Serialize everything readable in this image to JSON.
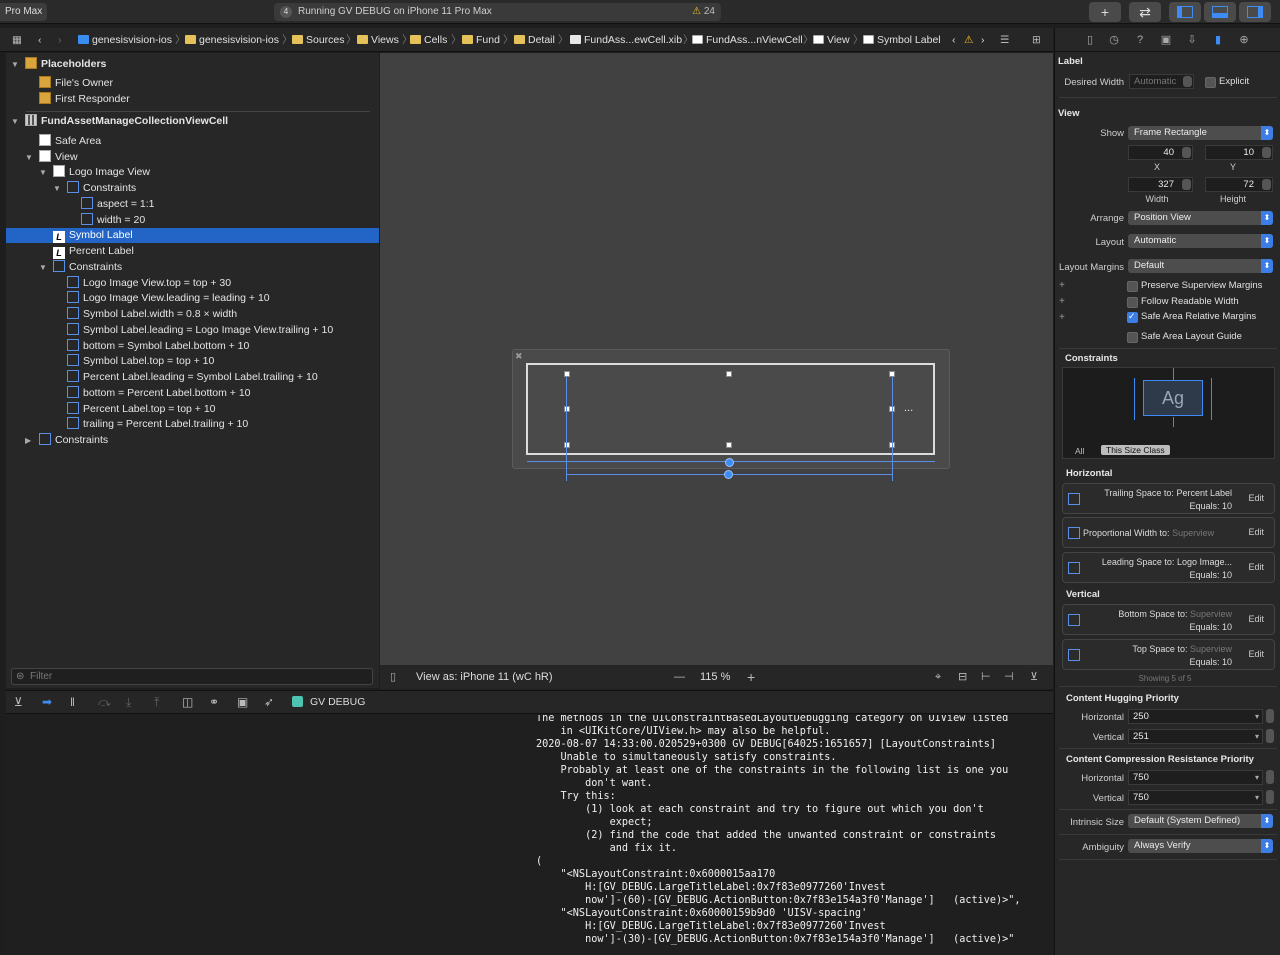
{
  "toolbar": {
    "scheme_label": "Pro Max",
    "activity_number": "4",
    "activity_text": "Running GV DEBUG on iPhone 11 Pro Max",
    "warning_count": "24",
    "warning_icon": "⚠",
    "add_icon": "+",
    "swap_icon": "⇄"
  },
  "jumpbar": {
    "crumbs": [
      "genesisvision-ios",
      "genesisvision-ios",
      "Sources",
      "Views",
      "Cells",
      "Fund",
      "Detail",
      "FundAss...ewCell.xib",
      "FundAss...nViewCell",
      "View",
      "Symbol Label"
    ]
  },
  "navigator": {
    "placeholders": "Placeholders",
    "files_owner": "File's Owner",
    "first_responder": "First Responder",
    "cell": "FundAssetManageCollectionViewCell",
    "safe_area": "Safe Area",
    "view": "View",
    "logo_image_view": "Logo Image View",
    "constraints_inner": "Constraints",
    "aspect": "aspect = 1:1",
    "width_20": "width = 20",
    "symbol_label": "Symbol Label",
    "percent_label": "Percent Label",
    "constraints": "Constraints",
    "c_rows": [
      "Logo Image View.top = top + 30",
      "Logo Image View.leading = leading + 10",
      "Symbol Label.width = 0.8 × width",
      "Symbol Label.leading = Logo Image View.trailing + 10",
      "bottom = Symbol Label.bottom + 10",
      "Symbol Label.top = top + 10",
      "Percent Label.leading = Symbol Label.trailing + 10",
      "bottom = Percent Label.bottom + 10",
      "Percent Label.top = top + 10",
      "trailing = Percent Label.trailing + 10"
    ],
    "constraints_outer": "Constraints",
    "filter_placeholder": "Filter"
  },
  "canvas": {
    "view_as": "View as: iPhone 11 (wC hR)",
    "zoom": "115 %",
    "zoom_minus": "—",
    "zoom_plus": "+",
    "ellipsis": "..."
  },
  "debug": {
    "target": "GV DEBUG"
  },
  "console": {
    "lines": [
      "The methods in the UIConstraintBasedLayoutDebugging category on UIView listed",
      "    in <UIKitCore/UIView.h> may also be helpful.",
      "2020-08-07 14:33:00.020529+0300 GV DEBUG[64025:1651657] [LayoutConstraints]",
      "    Unable to simultaneously satisfy constraints.",
      "    Probably at least one of the constraints in the following list is one you",
      "        don't want.",
      "    Try this:",
      "        (1) look at each constraint and try to figure out which you don't",
      "            expect;",
      "        (2) find the code that added the unwanted constraint or constraints",
      "            and fix it.",
      "(",
      "    \"<NSLayoutConstraint:0x6000015aa170",
      "        H:[GV_DEBUG.LargeTitleLabel:0x7f83e0977260'Invest",
      "        now']-(60)-[GV_DEBUG.ActionButton:0x7f83e154a3f0'Manage']   (active)>\",",
      "    \"<NSLayoutConstraint:0x60000159b9d0 'UISV-spacing'",
      "        H:[GV_DEBUG.LargeTitleLabel:0x7f83e0977260'Invest",
      "        now']-(30)-[GV_DEBUG.ActionButton:0x7f83e154a3f0'Manage']   (active)>\""
    ]
  },
  "inspector": {
    "label_section": "Label",
    "desired_width_label": "Desired Width",
    "desired_width_value": "Automatic",
    "explicit": "Explicit",
    "view_section": "View",
    "show_label": "Show",
    "show_value": "Frame Rectangle",
    "x_value": "40",
    "y_value": "10",
    "x_label": "X",
    "y_label": "Y",
    "width_value": "327",
    "height_value": "72",
    "width_label": "Width",
    "height_label": "Height",
    "arrange_label": "Arrange",
    "arrange_value": "Position View",
    "layout_label": "Layout",
    "layout_value": "Automatic",
    "layout_margins_label": "Layout Margins",
    "layout_margins_value": "Default",
    "preserve": "Preserve Superview Margins",
    "follow": "Follow Readable Width",
    "safe_area_margins": "Safe Area Relative Margins",
    "safe_area_guide": "Safe Area Layout Guide",
    "constraints_section": "Constraints",
    "ag": "Ag",
    "tab_all": "All",
    "tab_size_class": "This Size Class",
    "horizontal_section": "Horizontal",
    "h1_title": "Trailing Space to:",
    "h1_target": "Percent Label",
    "h1_eq": "Equals: 10",
    "h2_title": "Proportional Width to:",
    "h2_target": "Superview",
    "h3_title": "Leading Space to:",
    "h3_target": "Logo Image...",
    "h3_eq": "Equals: 10",
    "vertical_section": "Vertical",
    "v1_title": "Bottom Space to:",
    "v1_target": "Superview",
    "v1_eq": "Equals: 10",
    "v2_title": "Top Space to:",
    "v2_target": "Superview",
    "v2_eq": "Equals: 10",
    "edit": "Edit",
    "showing": "Showing 5 of 5",
    "hugging_section": "Content Hugging Priority",
    "hugging_h_label": "Horizontal",
    "hugging_h": "250",
    "hugging_v_label": "Vertical",
    "hugging_v": "251",
    "compression_section": "Content Compression Resistance Priority",
    "comp_h_label": "Horizontal",
    "comp_h": "750",
    "comp_v_label": "Vertical",
    "comp_v": "750",
    "intrinsic_label": "Intrinsic Size",
    "intrinsic_value": "Default (System Defined)",
    "ambiguity_label": "Ambiguity",
    "ambiguity_value": "Always Verify"
  },
  "colors": {
    "accent": "#3d8cf5",
    "selection": "#2265c7",
    "warning": "#f5c027"
  }
}
